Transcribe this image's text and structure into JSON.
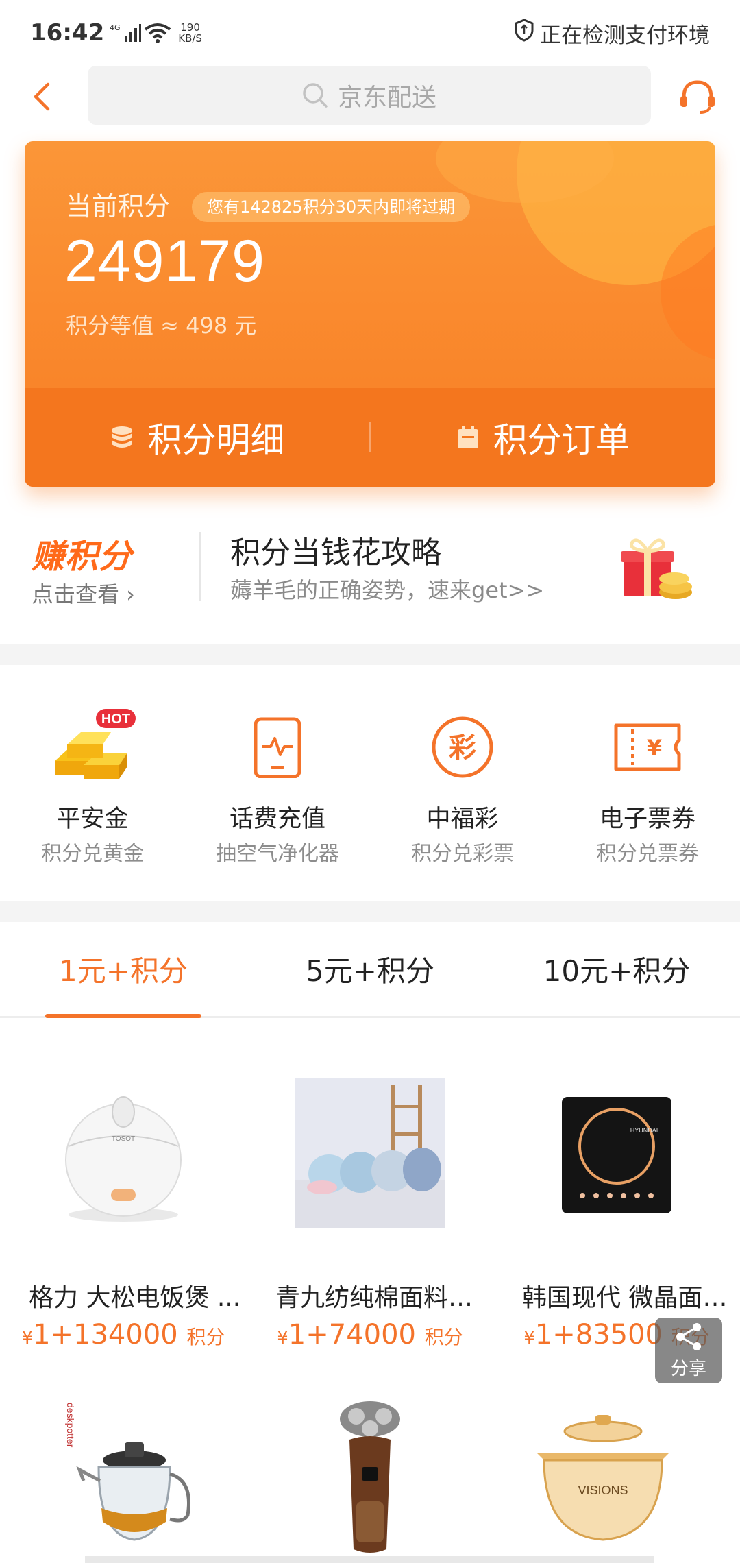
{
  "status_bar": {
    "time": "16:42",
    "network": "4G",
    "speed_value": "190",
    "speed_unit": "KB/S",
    "payment_check": "正在检测支付环境"
  },
  "header": {
    "search_placeholder": "京东配送",
    "icons": [
      "back-arrow-icon",
      "search-icon",
      "customer-service-icon"
    ]
  },
  "points_card": {
    "label": "当前积分",
    "expire_notice": "您有142825积分30天内即将过期",
    "value": "249179",
    "equivalent": "积分等值 ≈ 498 元",
    "actions": [
      {
        "label": "积分明细",
        "icon": "coins-icon"
      },
      {
        "label": "积分订单",
        "icon": "calendar-icon"
      }
    ]
  },
  "earn_banner": {
    "title": "赚积分",
    "link": "点击查看 ›",
    "headline": "积分当钱花攻略",
    "subline": "薅羊毛的正确姿势，速来get>>"
  },
  "services": [
    {
      "name": "平安金",
      "desc": "积分兑黄金",
      "badge": "HOT",
      "icon": "gold-bar-icon"
    },
    {
      "name": "话费充值",
      "desc": "抽空气净化器",
      "icon": "phone-recharge-icon"
    },
    {
      "name": "中福彩",
      "desc": "积分兑彩票",
      "icon_text": "彩",
      "icon": "lottery-icon"
    },
    {
      "name": "电子票券",
      "desc": "积分兑票券",
      "icon_text": "¥",
      "icon": "ticket-icon"
    }
  ],
  "tabs": [
    {
      "label": "1元+积分",
      "active": true
    },
    {
      "label": "5元+积分",
      "active": false
    },
    {
      "label": "10元+积分",
      "active": false
    }
  ],
  "products": [
    {
      "name": "格力 大松电饭煲 ...",
      "currency": "¥",
      "price": "1+134000",
      "unit": "积分",
      "image": "rice-cooker-image",
      "brand_mark": "TOSOT"
    },
    {
      "name": "青九纺纯棉面料春...",
      "currency": "¥",
      "price": "1+74000",
      "unit": "积分",
      "image": "blankets-image"
    },
    {
      "name": "韩国现代 微晶面板...",
      "currency": "¥",
      "price": "1+83500",
      "unit": "积分",
      "image": "induction-cooker-image",
      "brand_mark": "HYUNDAI"
    },
    {
      "name": "",
      "image": "teapot-image",
      "brand_mark": "deskpotter"
    },
    {
      "name": "",
      "image": "shaver-image"
    },
    {
      "name": "",
      "image": "glass-pot-image",
      "brand_mark": "VISIONS"
    }
  ],
  "share": {
    "label": "分享"
  },
  "colors": {
    "accent": "#f4732a",
    "card": "#f9852a",
    "earn_title": "#ff6a1a"
  }
}
